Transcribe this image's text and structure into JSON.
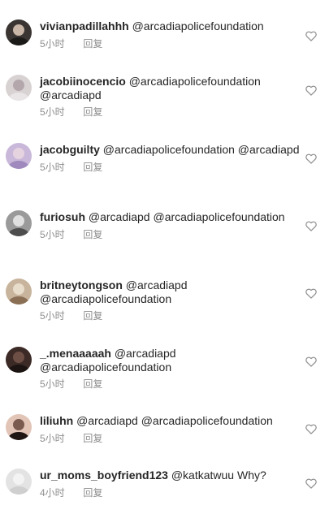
{
  "comments": [
    {
      "username": "vivianpadillahhh",
      "text": "@arcadiapolicefoundation",
      "time": "5小时",
      "reply": "回复",
      "avatar": {
        "c1": "#3a3532",
        "c2": "#c9b6a6",
        "c3": "#1c1a18"
      }
    },
    {
      "username": "jacobiinocencio",
      "text": "@arcadiapolicefoundation @arcadiapd",
      "time": "5小时",
      "reply": "回复",
      "avatar": {
        "c1": "#d8d2d3",
        "c2": "#b3a7ab",
        "c3": "#e9e5e6"
      }
    },
    {
      "username": "jacobguilty",
      "text": "@arcadiapolicefoundation @arcadiapd",
      "time": "5小时",
      "reply": "回复",
      "avatar": {
        "c1": "#c9b8d9",
        "c2": "#e6d3e0",
        "c3": "#9f89bd"
      }
    },
    {
      "username": "furiosuh",
      "text": "@arcadiapd @arcadiapolicefoundation",
      "time": "5小时",
      "reply": "回复",
      "avatar": {
        "c1": "#9a9a9a",
        "c2": "#e0e0e0",
        "c3": "#4d4d4d"
      }
    },
    {
      "username": "britneytongson",
      "text": "@arcadiapd @arcadiapolicefoundation",
      "time": "5小时",
      "reply": "回复",
      "avatar": {
        "c1": "#c8b49c",
        "c2": "#e8dccb",
        "c3": "#8a6f55"
      }
    },
    {
      "username": "_.menaaaaah",
      "text": "@arcadiapd @arcadiapolicefoundation",
      "time": "5小时",
      "reply": "回复",
      "avatar": {
        "c1": "#3b2a26",
        "c2": "#6e4f45",
        "c3": "#1c1412"
      }
    },
    {
      "username": "liliuhn",
      "text": "@arcadiapd @arcadiapolicefoundation",
      "time": "5小时",
      "reply": "回复",
      "avatar": {
        "c1": "#e3c5b7",
        "c2": "#7a5a4e",
        "c3": "#201613"
      }
    },
    {
      "username": "ur_moms_boyfriend123",
      "text": "@katkatwuu Why?",
      "time": "4小时",
      "reply": "回复",
      "avatar": {
        "c1": "#e3e3e3",
        "c2": "#f3f3f3",
        "c3": "#cfcfcf"
      }
    }
  ],
  "icons": {
    "like": "heart-outline-icon"
  },
  "colors": {
    "text": "#262626",
    "meta": "#8e8e8e",
    "heart_stroke": "#8e8e8e"
  }
}
